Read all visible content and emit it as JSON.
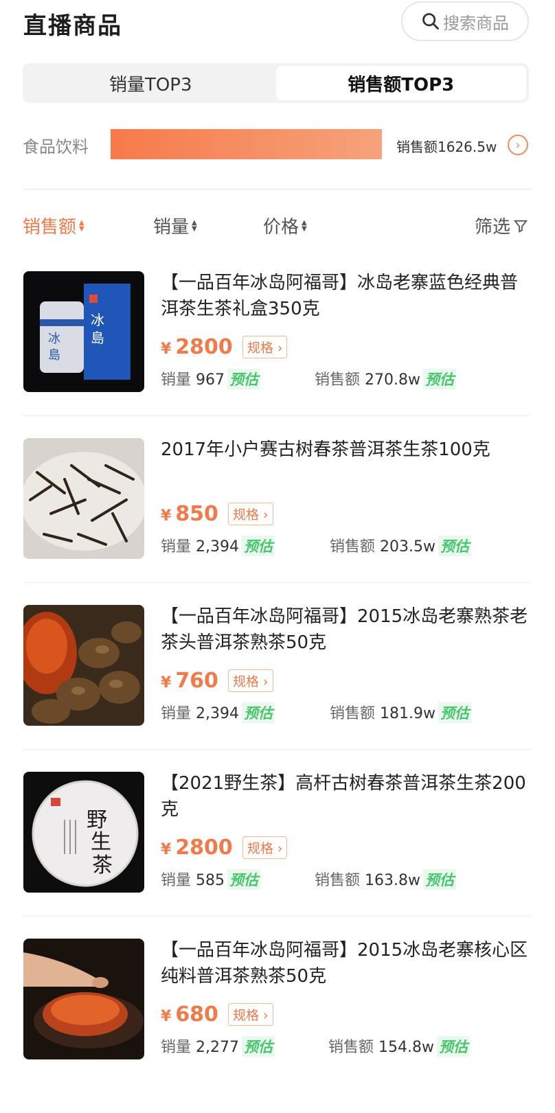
{
  "header": {
    "title": "直播商品",
    "search_label": "搜索商品"
  },
  "tabs": [
    {
      "label": "销量TOP3",
      "active": false
    },
    {
      "label": "销售额TOP3",
      "active": true
    }
  ],
  "category": {
    "label": "食品饮料",
    "value": "销售额1626.5w",
    "bar_fill_fraction": 1.0,
    "bar_color": "#f77a4b"
  },
  "sort": {
    "sales_amount": "销售额",
    "sales_volume": "销量",
    "price": "价格",
    "filter": "筛选"
  },
  "labels": {
    "volume": "销量",
    "revenue": "销售额",
    "estimate": "预估",
    "spec": "规格",
    "currency": "¥"
  },
  "colors": {
    "accent": "#f07a4a",
    "estimate_green": "#49c66d"
  },
  "products": [
    {
      "name": "【一品百年冰岛阿福哥】冰岛老寨蓝色经典普洱茶生茶礼盒350克",
      "price": "2800",
      "volume": "967",
      "revenue": "270.8w",
      "image": "tea-gift-box-icon"
    },
    {
      "name": "2017年小户赛古树春茶普洱茶生茶100克",
      "price": "850",
      "volume": "2,394",
      "revenue": "203.5w",
      "image": "loose-tea-leaves-icon"
    },
    {
      "name": "【一品百年冰岛阿福哥】2015冰岛老寨熟茶老茶头普洱茶熟茶50克",
      "price": "760",
      "volume": "2,394",
      "revenue": "181.9w",
      "image": "tea-nuggets-icon"
    },
    {
      "name": "【2021野生茶】高杆古树春茶普洱茶生茶200克",
      "price": "2800",
      "volume": "585",
      "revenue": "163.8w",
      "image": "tea-cake-icon"
    },
    {
      "name": "【一品百年冰岛阿福哥】2015冰岛老寨核心区纯料普洱茶熟茶50克",
      "price": "680",
      "volume": "2,277",
      "revenue": "154.8w",
      "image": "tea-cup-icon"
    }
  ]
}
